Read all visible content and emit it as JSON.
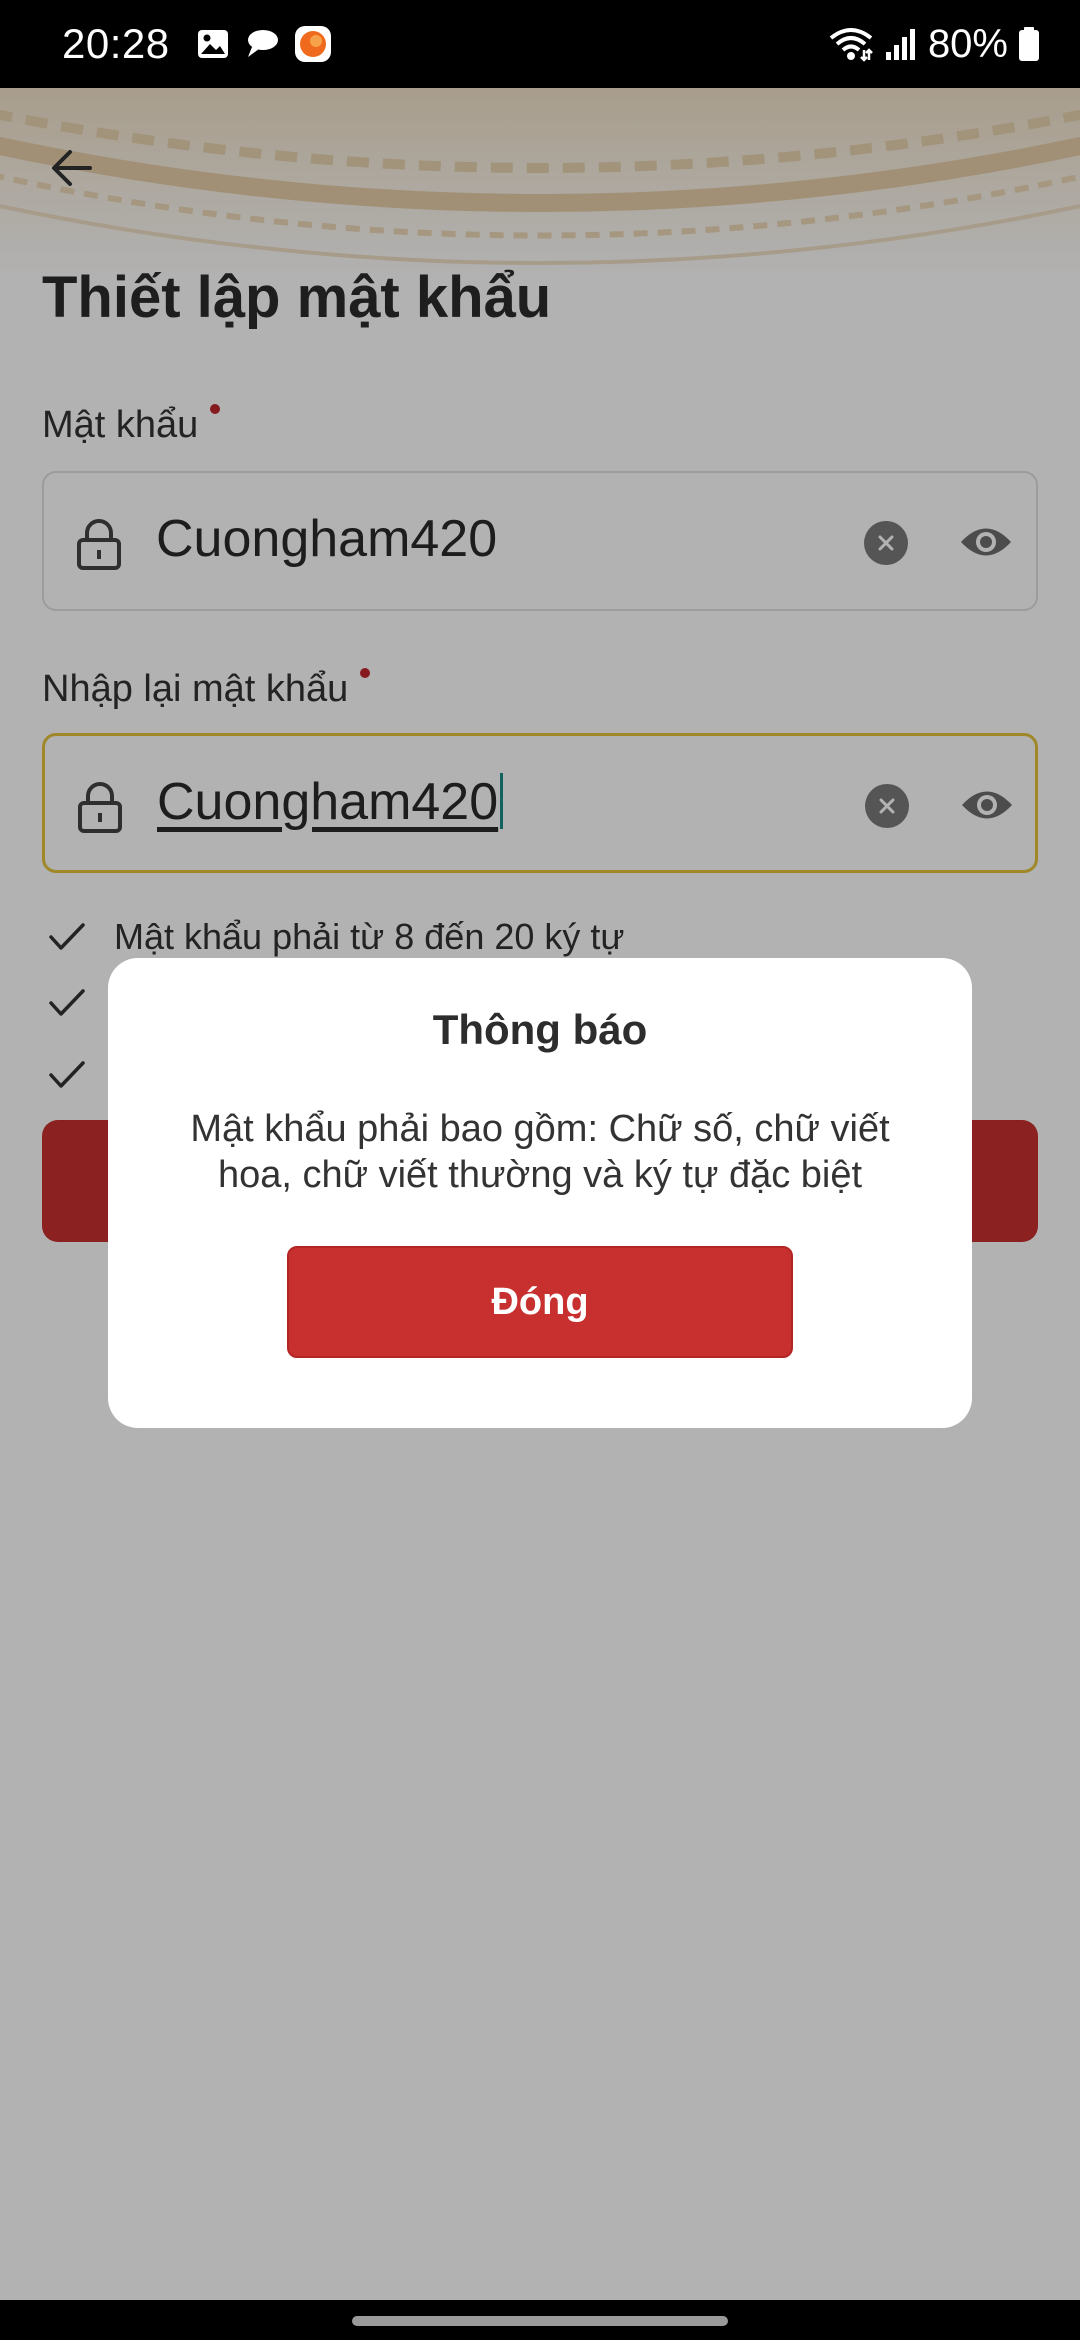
{
  "status_bar": {
    "time": "20:28",
    "battery": "80%",
    "icons": [
      "gallery-icon",
      "chat-icon",
      "app-notification-icon",
      "wifi-icon",
      "signal-icon",
      "battery-icon"
    ]
  },
  "header": {
    "title": "Thiết lập mật khẩu"
  },
  "form": {
    "password": {
      "label": "Mật khẩu",
      "value": "Cuongham420"
    },
    "confirm_password": {
      "label": "Nhập lại mật khẩu",
      "value": "Cuongham420"
    },
    "rules": [
      "Mật khẩu phải từ 8 đến 20 ký tự"
    ]
  },
  "dialog": {
    "title": "Thông báo",
    "message": "Mật khẩu phải bao gồm: Chữ số, chữ viết hoa, chữ viết thường và ký tự đặc biệt",
    "close_label": "Đóng"
  },
  "colors": {
    "primary_red": "#c8302f",
    "focus_border": "#e6c23a",
    "required_dot": "#c0272d"
  }
}
